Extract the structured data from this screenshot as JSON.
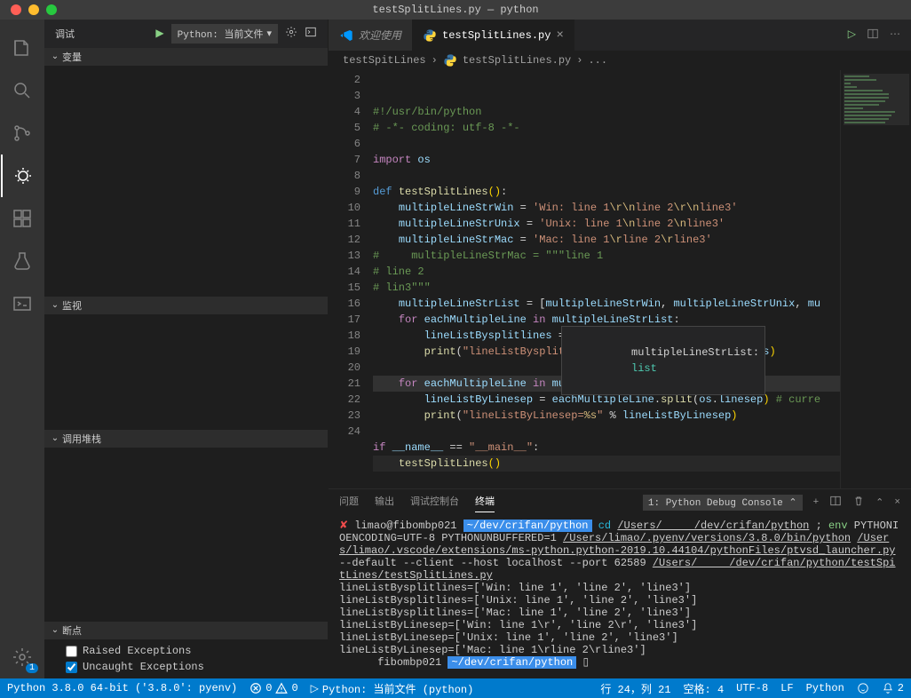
{
  "titlebar": {
    "title": "testSplitLines.py — python"
  },
  "sidebar": {
    "header": "调试",
    "config": "Python: 当前文件",
    "sections": {
      "variables": "变量",
      "watch": "监视",
      "callstack": "调用堆栈",
      "breakpoints": "断点"
    },
    "breakpoints": [
      {
        "label": "Raised Exceptions",
        "checked": false
      },
      {
        "label": "Uncaught Exceptions",
        "checked": true
      }
    ]
  },
  "tabs": {
    "welcome": "欢迎使用",
    "file": "testSplitLines.py"
  },
  "breadcrumb": {
    "folder": "testSpitLines",
    "file": "testSplitLines.py",
    "more": "..."
  },
  "tooltip": {
    "var": "multipleLineStrList:",
    "type": "list"
  },
  "code": {
    "start": 2,
    "lines": [
      {
        "n": 2,
        "html": "<span class='com'>#!/usr/bin/python</span>"
      },
      {
        "n": 3,
        "html": "<span class='com'># -*- coding: utf-8 -*-</span>"
      },
      {
        "n": 4,
        "html": ""
      },
      {
        "n": 5,
        "html": "<span class='kw'>import</span> <span class='id'>os</span>"
      },
      {
        "n": 6,
        "html": ""
      },
      {
        "n": 7,
        "html": "<span class='def'>def</span> <span class='fn'>testSplitLines</span><span class='paren'>()</span>:"
      },
      {
        "n": 8,
        "html": "    <span class='id'>multipleLineStrWin</span> = <span class='str'>'Win: line 1<span class='esc'>\\r\\n</span>line 2<span class='esc'>\\r\\n</span>line3'</span>"
      },
      {
        "n": 9,
        "html": "    <span class='id'>multipleLineStrUnix</span> = <span class='str'>'Unix: line 1<span class='esc'>\\n</span>line 2<span class='esc'>\\n</span>line3'</span>"
      },
      {
        "n": 10,
        "html": "    <span class='id'>multipleLineStrMac</span> = <span class='str'>'Mac: line 1<span class='esc'>\\r</span>line 2<span class='esc'>\\r</span>line3'</span>"
      },
      {
        "n": 11,
        "html": "<span class='com'>#     multipleLineStrMac = \"\"\"line 1</span>"
      },
      {
        "n": 12,
        "html": "<span class='com'># line 2</span>"
      },
      {
        "n": 13,
        "html": "<span class='com'># lin3\"\"\"</span>"
      },
      {
        "n": 14,
        "html": "    <span class='id'>multipleLineStrList</span> = [<span class='id'>multipleLineStrWin</span>, <span class='id'>multipleLineStrUnix</span>, <span class='id'>mu</span>"
      },
      {
        "n": 15,
        "html": "    <span class='kw'>for</span> <span class='id'>eachMultipleLine</span> <span class='kw'>in</span> <span class='id'>multipleLineStrList</span>:"
      },
      {
        "n": 16,
        "html": "        <span class='id'>lineListBysplitlines</span> = <span class='id'>eachMultipleLine</span>.<span class='fn'>splitlines</span><span class='paren'>()</span>"
      },
      {
        "n": 17,
        "html": "        <span class='fn'>print</span>(<span class='str'>\"lineListBysplitlines=<span class='esc'>%s</span>\"</span> % <span class='id'>lineListBysplitlines</span><span class='paren'>)</span>"
      },
      {
        "n": 18,
        "html": ""
      },
      {
        "n": 19,
        "html": "    <span class='kw'>for</span> <span class='id'>eachMultipleLine</span> <span class='kw'>in</span> <span class='id'>multipleLineStrList</span>:"
      },
      {
        "n": 20,
        "html": "        <span class='id'>lineListByLinesep</span> = <span class='id'>eachMultipleLine</span>.<span class='fn'>split</span>(<span class='id'>os</span>.<span class='id'>linesep</span><span class='paren'>)</span> <span class='com'># curre</span>"
      },
      {
        "n": 21,
        "html": "        <span class='fn'>print</span>(<span class='str'>\"lineListByLinesep=<span class='esc'>%s</span>\"</span> % <span class='id'>lineListByLinesep</span><span class='paren'>)</span>"
      },
      {
        "n": 22,
        "html": ""
      },
      {
        "n": 23,
        "html": "<span class='kw'>if</span> <span class='id'>__name__</span> == <span class='str'>\"__main__\"</span>:"
      },
      {
        "n": 24,
        "html": "    <span class='fn'>testSplitLines</span><span class='paren'>()</span>"
      }
    ]
  },
  "panel": {
    "tabs": {
      "problems": "问题",
      "output": "输出",
      "debug": "调试控制台",
      "terminal": "终端"
    },
    "selector": "1: Python Debug Console",
    "terminal_lines": [
      {
        "type": "prompt",
        "user": "limao@fibombp021",
        "path": "~/dev/crifan/python",
        "cmd_pre": "cd",
        "cmd_link": "/Users/     /dev/crifan/python",
        "sep": " ; ",
        "env": "env",
        "rest": " PYTHONIOENCODING=UTF-8 PYTHONUNBUFFERED=1 "
      },
      {
        "type": "link",
        "text": "/Users/limao/.pyenv/versions/3.8.0/bin/python"
      },
      {
        "type": "link",
        "text": "/Users/limao/.vscode/extensions/ms-python.python-2019.10.44104/pythonFiles/ptvsd_launcher.py"
      },
      {
        "type": "plain",
        "text": " --default --client --host localhost --port 62589 "
      },
      {
        "type": "link",
        "text": "/Users/     /dev/crifan/python/testSpitLines/testSplitLines.py"
      },
      {
        "type": "out",
        "text": "lineListBysplitlines=['Win: line 1', 'line 2', 'line3']"
      },
      {
        "type": "out",
        "text": "lineListBysplitlines=['Unix: line 1', 'line 2', 'line3']"
      },
      {
        "type": "out",
        "text": "lineListBysplitlines=['Mac: line 1', 'line 2', 'line3']"
      },
      {
        "type": "out",
        "text": "lineListByLinesep=['Win: line 1\\r', 'line 2\\r', 'line3']"
      },
      {
        "type": "out",
        "text": "lineListByLinesep=['Unix: line 1', 'line 2', 'line3']"
      },
      {
        "type": "out",
        "text": "lineListByLinesep=['Mac: line 1\\rline 2\\rline3']"
      },
      {
        "type": "prompt2",
        "user": "fibombp021",
        "path": "~/dev/crifan/python"
      }
    ]
  },
  "statusbar": {
    "python": "Python 3.8.0 64-bit ('3.8.0': pyenv)",
    "errors": "0",
    "warnings": "0",
    "debug": "Python: 当前文件 (python)",
    "line_col": "行 24，列 21",
    "spaces": "空格: 4",
    "encoding": "UTF-8",
    "eol": "LF",
    "lang": "Python",
    "bell": "2",
    "gear_badge": "1"
  }
}
